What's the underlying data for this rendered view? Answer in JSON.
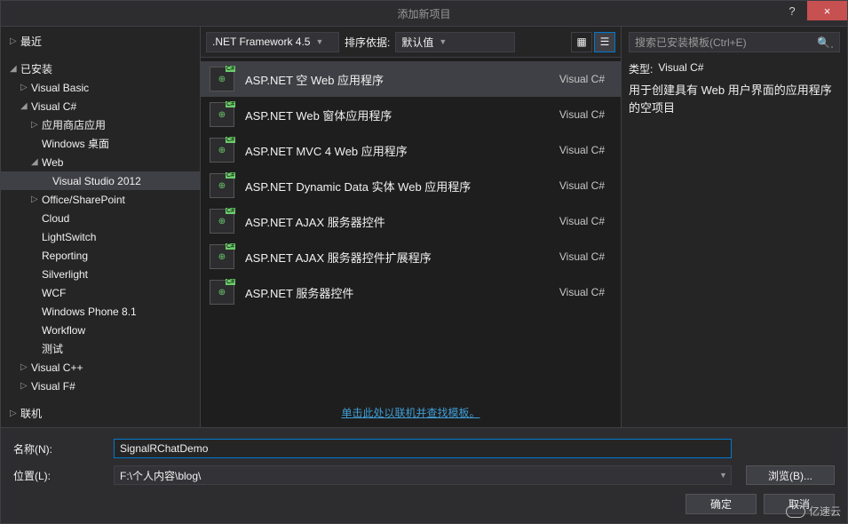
{
  "titlebar": {
    "title": "添加新项目",
    "help": "?",
    "close": "×"
  },
  "sidebar": {
    "recent": "最近",
    "installed": "已安装",
    "items": [
      {
        "label": "Visual Basic",
        "indent": 1,
        "expander": "closed"
      },
      {
        "label": "Visual C#",
        "indent": 1,
        "expander": "open"
      },
      {
        "label": "应用商店应用",
        "indent": 2,
        "expander": "closed"
      },
      {
        "label": "Windows 桌面",
        "indent": 2,
        "expander": "none"
      },
      {
        "label": "Web",
        "indent": 2,
        "expander": "open"
      },
      {
        "label": "Visual Studio 2012",
        "indent": 3,
        "expander": "none",
        "selected": true
      },
      {
        "label": "Office/SharePoint",
        "indent": 2,
        "expander": "closed"
      },
      {
        "label": "Cloud",
        "indent": 2,
        "expander": "none"
      },
      {
        "label": "LightSwitch",
        "indent": 2,
        "expander": "none"
      },
      {
        "label": "Reporting",
        "indent": 2,
        "expander": "none"
      },
      {
        "label": "Silverlight",
        "indent": 2,
        "expander": "none"
      },
      {
        "label": "WCF",
        "indent": 2,
        "expander": "none"
      },
      {
        "label": "Windows Phone 8.1",
        "indent": 2,
        "expander": "none"
      },
      {
        "label": "Workflow",
        "indent": 2,
        "expander": "none"
      },
      {
        "label": "测试",
        "indent": 2,
        "expander": "none"
      },
      {
        "label": "Visual C++",
        "indent": 1,
        "expander": "closed"
      },
      {
        "label": "Visual F#",
        "indent": 1,
        "expander": "closed"
      }
    ],
    "online": "联机"
  },
  "toolbar": {
    "framework": ".NET Framework 4.5",
    "sort_label": "排序依据:",
    "sort_value": "默认值"
  },
  "templates": [
    {
      "name": "ASP.NET 空 Web 应用程序",
      "lang": "Visual C#",
      "selected": true
    },
    {
      "name": "ASP.NET Web 窗体应用程序",
      "lang": "Visual C#"
    },
    {
      "name": "ASP.NET MVC 4 Web 应用程序",
      "lang": "Visual C#"
    },
    {
      "name": "ASP.NET Dynamic Data 实体 Web 应用程序",
      "lang": "Visual C#"
    },
    {
      "name": "ASP.NET AJAX 服务器控件",
      "lang": "Visual C#"
    },
    {
      "name": "ASP.NET AJAX 服务器控件扩展程序",
      "lang": "Visual C#"
    },
    {
      "name": "ASP.NET 服务器控件",
      "lang": "Visual C#"
    }
  ],
  "online_link": "单击此处以联机并查找模板。",
  "search": {
    "placeholder": "搜索已安装模板(Ctrl+E)"
  },
  "description": {
    "type_label": "类型:",
    "type_value": "Visual C#",
    "text": "用于创建具有 Web 用户界面的应用程序的空项目"
  },
  "form": {
    "name_label": "名称(N):",
    "name_value": "SignalRChatDemo",
    "location_label": "位置(L):",
    "location_value": "F:\\个人内容\\blog\\",
    "browse": "浏览(B)...",
    "ok": "确定",
    "cancel": "取消"
  },
  "watermark": "亿速云"
}
